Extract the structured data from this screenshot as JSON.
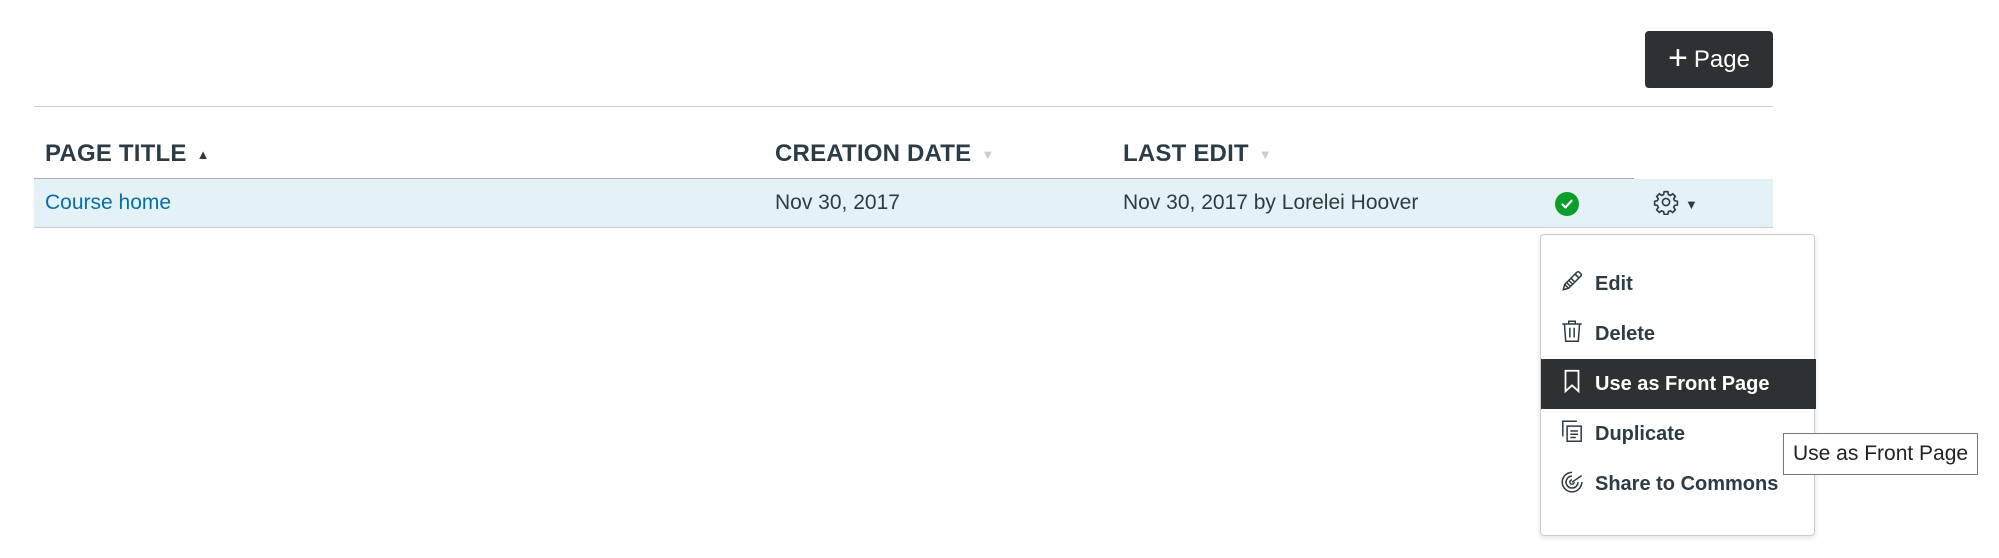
{
  "toolbar": {
    "add_page_label": "Page"
  },
  "table": {
    "columns": [
      {
        "label": "PAGE TITLE",
        "sort": "ascending"
      },
      {
        "label": "CREATION DATE",
        "sort": "none"
      },
      {
        "label": "LAST EDIT",
        "sort": "none"
      }
    ],
    "rows": [
      {
        "title": "Course home",
        "created": "Nov 30, 2017",
        "last_edit": "Nov 30, 2017 by Lorelei Hoover",
        "status": "published"
      }
    ]
  },
  "menu": {
    "items": [
      {
        "label": "Edit",
        "icon": "pencil-icon"
      },
      {
        "label": "Delete",
        "icon": "trash-icon"
      },
      {
        "label": "Use as Front Page",
        "icon": "bookmark-icon",
        "highlighted": true
      },
      {
        "label": "Duplicate",
        "icon": "copy-icon"
      },
      {
        "label": "Share to Commons",
        "icon": "share-icon"
      }
    ]
  },
  "tooltip": {
    "text": "Use as Front Page"
  },
  "colors": {
    "link": "#0770a3",
    "row_highlight": "#e4f1f7",
    "published": "#0b9e2a",
    "dark_button": "#2d3134"
  }
}
